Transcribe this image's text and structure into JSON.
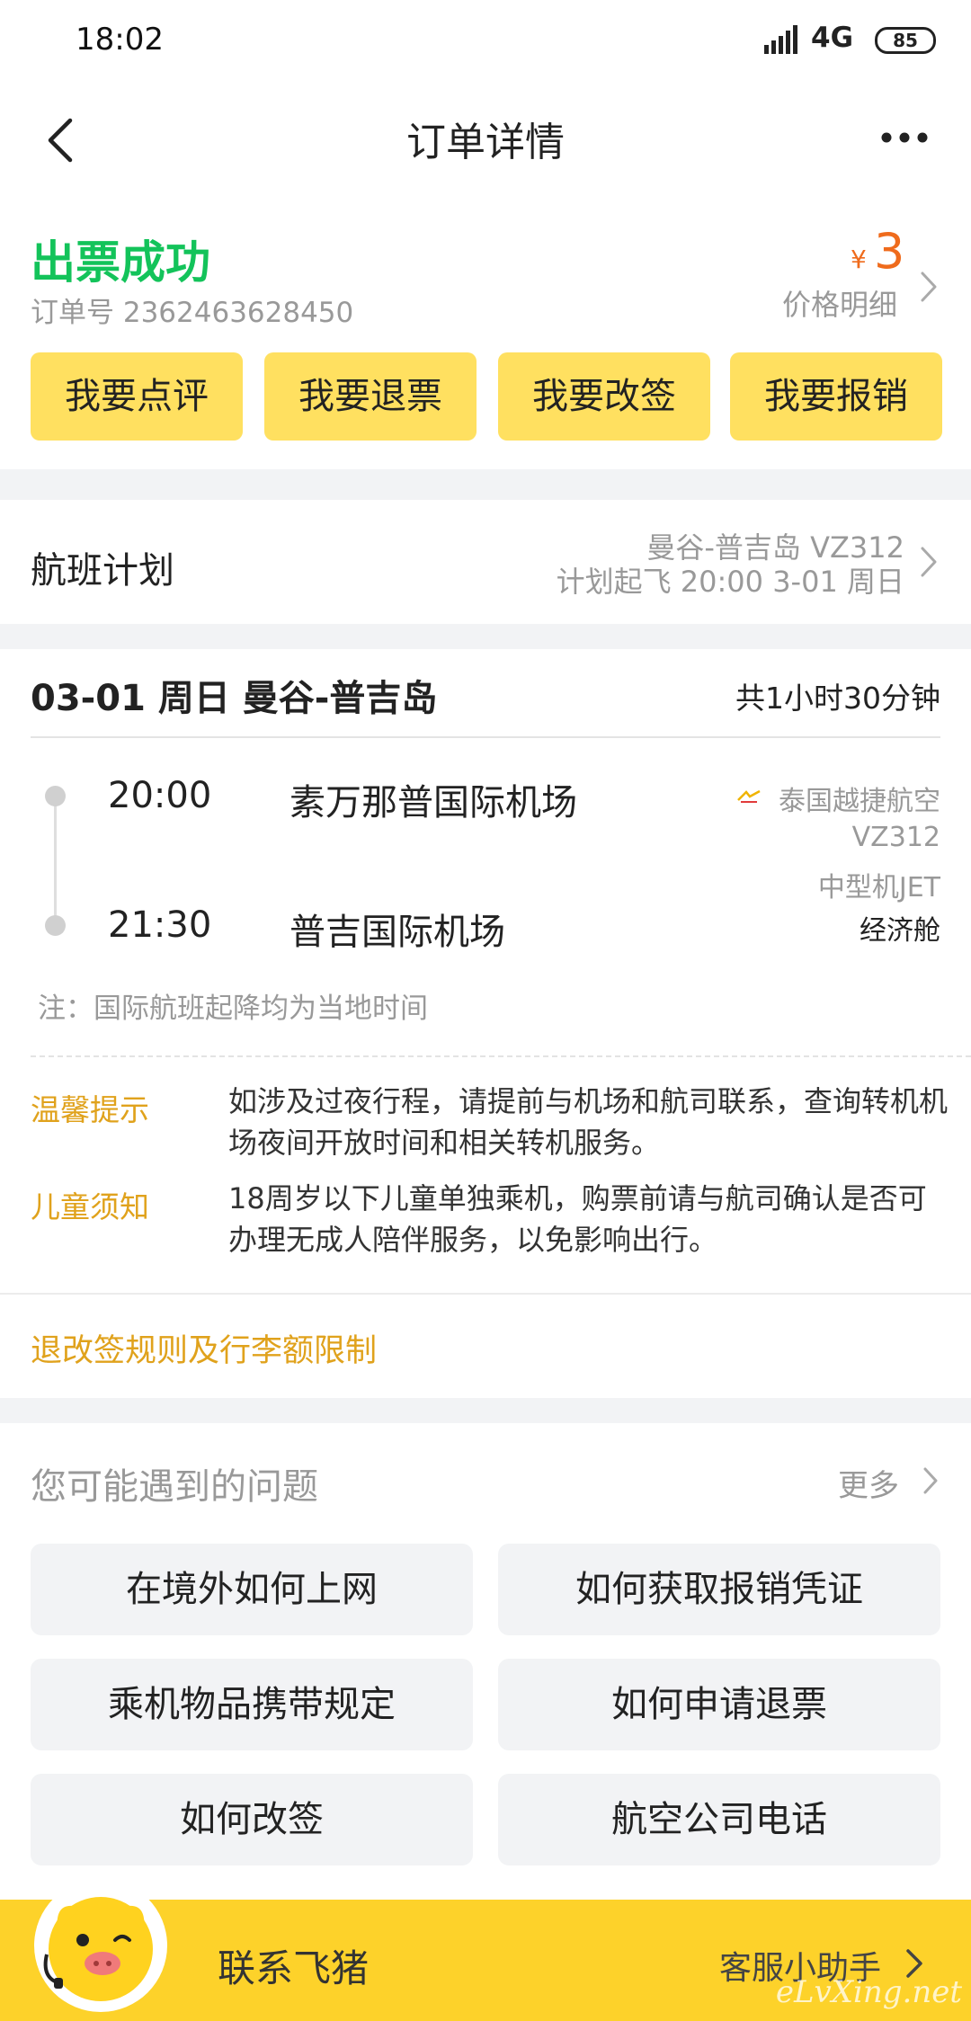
{
  "status_bar": {
    "time": "18:02",
    "network": "4G",
    "battery": "85"
  },
  "nav": {
    "title": "订单详情"
  },
  "order": {
    "status": "出票成功",
    "order_number": "订单号 2362463628450",
    "price_symbol": "¥",
    "price_amount": "3",
    "price_detail_label": "价格明细",
    "status_color": "#13c35a",
    "price_color": "#ef6b1c",
    "actions": [
      {
        "label": "我要点评"
      },
      {
        "label": "我要退票"
      },
      {
        "label": "我要改签"
      },
      {
        "label": "我要报销"
      }
    ]
  },
  "flight_plan": {
    "label": "航班计划",
    "route": "曼谷-普吉岛 VZ312",
    "time": "计划起飞 20:00 3-01 周日"
  },
  "flight": {
    "header_title": "03-01 周日 曼谷-普吉岛",
    "duration": "共1小时30分钟",
    "departure": {
      "time": "20:00",
      "airport": "素万那普国际机场"
    },
    "arrival": {
      "time": "21:30",
      "airport": "普吉国际机场"
    },
    "airline_name": "泰国越捷航空",
    "flight_number": "VZ312",
    "aircraft_type": "中型机JET",
    "cabin_class": "经济舱",
    "note": "注：国际航班起降均为当地时间"
  },
  "tips": [
    {
      "label": "温馨提示",
      "text": "如涉及过夜行程，请提前与机场和航司联系，查询转机机场夜间开放时间和相关转机服务。"
    },
    {
      "label": "儿童须知",
      "text": "18周岁以下儿童单独乘机，购票前请与航司确认是否可办理无成人陪伴服务，以免影响出行。"
    }
  ],
  "rules_link": "退改签规则及行李额限制",
  "faq": {
    "title": "您可能遇到的问题",
    "more": "更多",
    "items": [
      {
        "label": "在境外如何上网"
      },
      {
        "label": "如何获取报销凭证"
      },
      {
        "label": "乘机物品携带规定"
      },
      {
        "label": "如何申请退票"
      },
      {
        "label": "如何改签"
      },
      {
        "label": "航空公司电话"
      }
    ]
  },
  "contact": {
    "title": "联系飞猪",
    "helper": "客服小助手",
    "watermark": "eLvXing.net",
    "bar_color": "#fdd22a"
  },
  "icons": [
    "back-icon",
    "more-icon",
    "chevron-right-icon",
    "signal-icon",
    "battery-icon",
    "airline-logo-icon",
    "mascot-icon"
  ]
}
